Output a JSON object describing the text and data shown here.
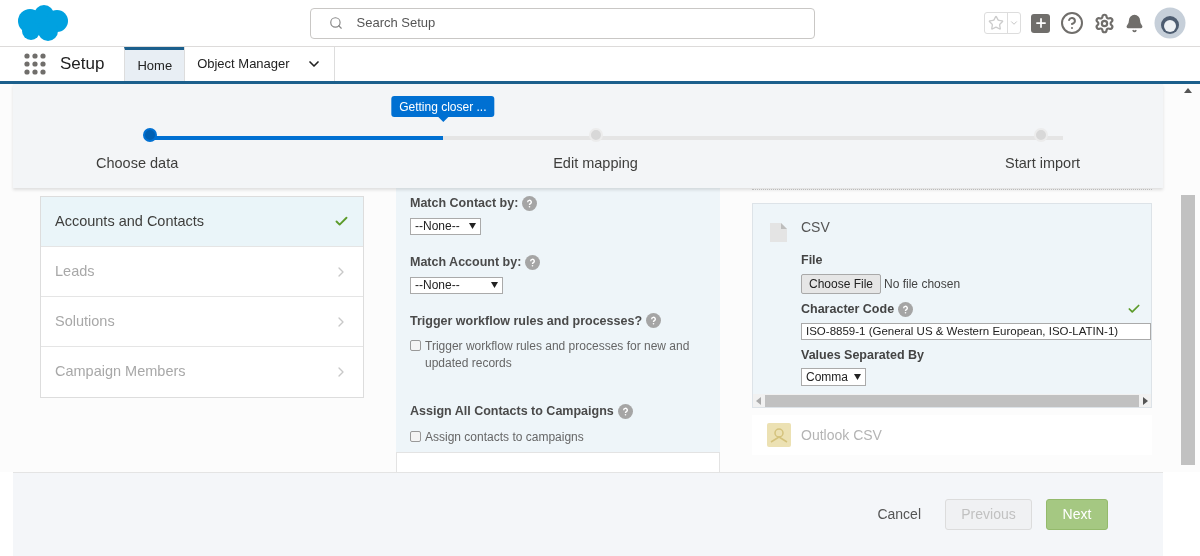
{
  "header": {
    "search": {
      "placeholder": "Search Setup"
    }
  },
  "nav": {
    "app_name": "Setup",
    "tabs": [
      {
        "label": "Home",
        "selected": true,
        "kind": "plain"
      },
      {
        "label": "Object Manager",
        "selected": false,
        "kind": "menu"
      }
    ]
  },
  "wizard": {
    "tooltip": "Getting closer ...",
    "level": 0.32,
    "steps": [
      {
        "label": "Choose data",
        "done": true
      },
      {
        "label": "Edit mapping",
        "done": false
      },
      {
        "label": "Start import",
        "done": false
      }
    ]
  },
  "object_list": [
    {
      "label": "Accounts and Contacts",
      "selected": true
    },
    {
      "label": "Leads",
      "selected": false
    },
    {
      "label": "Solutions",
      "selected": false
    },
    {
      "label": "Campaign Members",
      "selected": false
    }
  ],
  "options": [
    {
      "kind": "select",
      "label": "Match Contact by:",
      "value": "--None--",
      "wide": false
    },
    {
      "kind": "select",
      "label": "Match Account by:",
      "value": "--None--",
      "wide": true
    },
    {
      "kind": "checkbox",
      "label": "Trigger workflow rules and processes?",
      "checkbox_label": "Trigger workflow rules and processes for new and updated records",
      "checked": false
    },
    {
      "kind": "checkbox",
      "label": "Assign All Contacts to Campaigns",
      "checkbox_label": "Assign contacts to campaigns",
      "checked": false
    }
  ],
  "sources": [
    {
      "label": "CSV",
      "expanded": true,
      "kind": "csv",
      "file_label": "File",
      "file_button": "Choose File",
      "file_status": "No file chosen",
      "charset_label": "Character Code",
      "charset_valid": true,
      "charset_value": "ISO-8859-1 (General US & Western European, ISO-LATIN-1)",
      "separator_label": "Values Separated By",
      "separator_value": "Comma"
    },
    {
      "label": "Outlook CSV",
      "expanded": false,
      "kind": "outlook"
    }
  ],
  "footer": {
    "cancel": "Cancel",
    "previous": {
      "label": "Previous",
      "disabled": true
    },
    "next": {
      "label": "Next",
      "disabled": false
    }
  }
}
